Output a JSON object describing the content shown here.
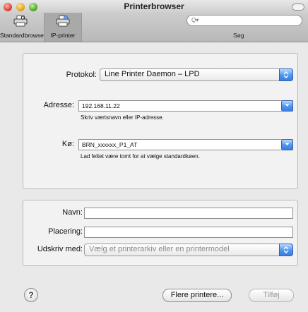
{
  "window": {
    "title": "Printerbrowser"
  },
  "toolbar": {
    "standard_label": "Standardbrowser",
    "ip_label": "IP-printer",
    "search_caption": "Søg",
    "search_placeholder": ""
  },
  "form": {
    "protocol_label": "Protokol:",
    "protocol_value": "Line Printer Daemon – LPD",
    "address_label": "Adresse:",
    "address_value": "192.168.11.22",
    "address_hint": "Skriv værtsnavn eller IP-adresse.",
    "queue_label": "Kø:",
    "queue_value": "BRN_xxxxxx_P1_AT",
    "queue_hint": "Lad feltet være tomt for at vælge standardkøen.",
    "name_label": "Navn:",
    "name_value": "",
    "location_label": "Placering:",
    "location_value": "",
    "print_using_label": "Udskriv med:",
    "print_using_value": "Vælg et printerarkiv eller en printermodel"
  },
  "footer": {
    "help": "?",
    "more_printers": "Flere printere...",
    "add": "Tilføj"
  },
  "colors": {
    "accent_blue": "#4f93ec",
    "panel_bg": "#f2f2f2"
  }
}
